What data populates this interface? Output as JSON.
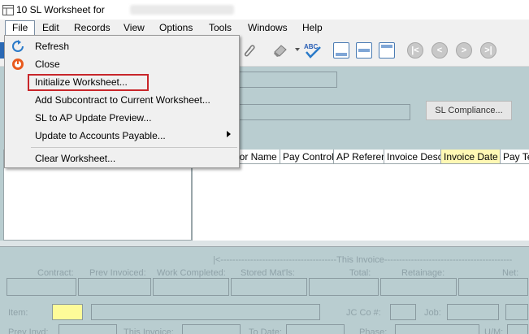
{
  "window": {
    "title": "10 SL Worksheet for"
  },
  "menubar": {
    "items": [
      "File",
      "Edit",
      "Records",
      "View",
      "Options",
      "Tools",
      "Windows",
      "Help"
    ]
  },
  "file_menu": {
    "items": [
      {
        "label": "Refresh",
        "icon": "refresh-icon"
      },
      {
        "label": "Close",
        "icon": "close-icon"
      },
      {
        "label": "Initialize Worksheet..."
      },
      {
        "label": "Add Subcontract to Current Worksheet..."
      },
      {
        "label": "SL to AP Update Preview..."
      },
      {
        "label": "Update to Accounts Payable...",
        "submenu": true
      },
      {
        "label": "Clear Worksheet..."
      }
    ]
  },
  "header": {
    "sl_compliance_label": "SL Compliance..."
  },
  "grid": {
    "columns": [
      "dor Name",
      "Pay Control",
      "AP Referenc",
      "Invoice Desc",
      "Invoice Date",
      "Pay Te"
    ]
  },
  "bottom": {
    "section_title": "|<---------------------------------------This Invoice-------------------------------------------",
    "labels": [
      "Contract:",
      "Prev Invoiced:",
      "Work Completed:",
      "Stored Mat'ls:",
      "Total:",
      "Retainage:",
      "Net:"
    ],
    "item_label": "Item:",
    "jc_label": "JC Co #:",
    "job_label": "Job:",
    "prev_invd": "Prev Invd:",
    "this_invoice": "This Invoice:",
    "to_date": "To Date:",
    "phase": "Phase:",
    "um": "U/M:"
  },
  "colors": {
    "highlight_red": "#c8262a",
    "yellow_field": "#fefb99",
    "form_bg": "#b9cdd0"
  }
}
